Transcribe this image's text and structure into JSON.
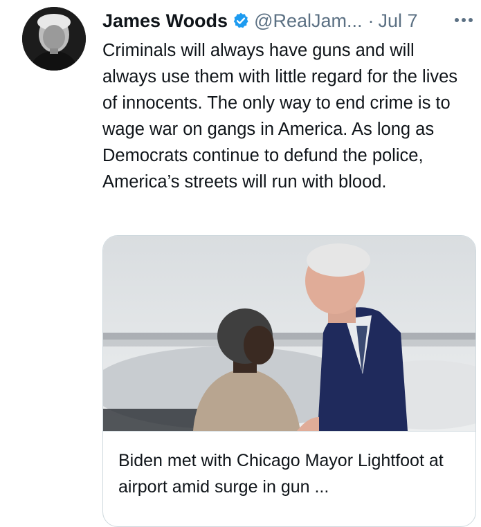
{
  "tweet": {
    "author": {
      "name": "James Woods",
      "handle": "@RealJam...",
      "verified": true,
      "avatar_icon": "profile-photo"
    },
    "separator": "·",
    "time": "Jul 7",
    "more_icon": "more-horizontal-icon",
    "text": "Criminals will always have guns and will always use them with little regard for the lives of innocents. The only way to end crime is to wage war on gangs in America. As long as Democrats continue to defund the police, America’s streets will run with blood.",
    "card": {
      "image_icon": "news-photo",
      "title": "Biden met with Chicago Mayor Lightfoot at airport amid surge in gun ..."
    }
  },
  "colors": {
    "text": "#0f1419",
    "secondary": "#5b7083",
    "verified": "#1d9bf0",
    "border": "#cfd9de"
  }
}
